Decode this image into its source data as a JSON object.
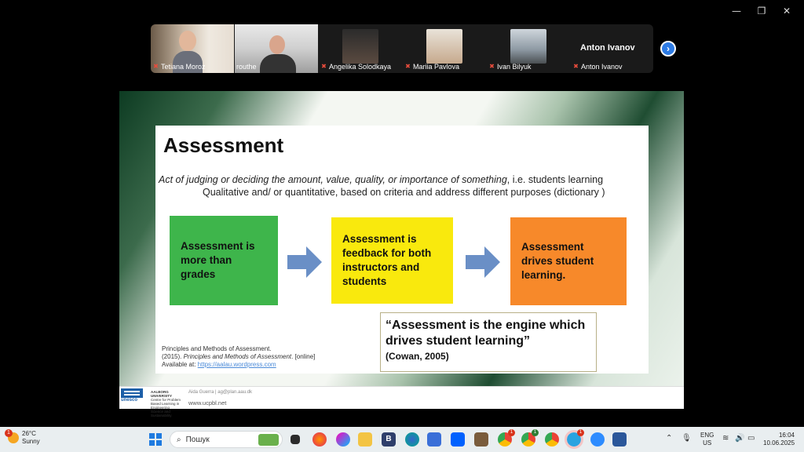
{
  "window": {
    "minimize_icon": "minimize-icon",
    "restore_icon": "restore-icon",
    "close_icon": "close-icon"
  },
  "participants": [
    {
      "name": "Tetiana Moroz",
      "muted": true
    },
    {
      "name": "routhe",
      "muted": false,
      "active_speaker": true
    },
    {
      "name": "Angelika Solodkaya",
      "muted": true
    },
    {
      "name": "Mariia Pavlova",
      "muted": true
    },
    {
      "name": "Ivan Bilyuk",
      "muted": true
    },
    {
      "name": "Anton Ivanov",
      "muted": true,
      "video_off_label": "Anton Ivanov"
    }
  ],
  "slide": {
    "title": "Assessment",
    "definition_italic": "Act of judging or deciding the amount, value, quality, or importance of something",
    "definition_rest": ", i.e. students learning",
    "definition_line2": "Qualitative and/ or quantitative, based on criteria and address different purposes (dictionary )",
    "boxes": [
      {
        "text": "Assessment is more than grades",
        "color": "#3eb54b"
      },
      {
        "text": "Assessment is feedback for both instructors and students",
        "color": "#f9e90d"
      },
      {
        "text": "Assessment drives student learning.",
        "color": "#f7892a"
      }
    ],
    "arrow_color": "#6a8fc6",
    "quote": "“Assessment is the engine which drives student learning”",
    "quote_cite": "(Cowan, 2005)",
    "reference_line1": "Principles and Methods of Assessment.",
    "reference_line2_prefix": "(2015). ",
    "reference_line2_italic": "Principles and Methods of Assessment",
    "reference_line2_suffix": ". [online]",
    "reference_line3_prefix": "Available at: ",
    "reference_link": "https://aalau.wordpress.com",
    "footer_logo_text": "unesco",
    "footer_university": "AALBORG UNIVERSITY",
    "footer_center": "Centre for Problem Based Learning in Engineering Science and Sustainability",
    "footer_contact": "Aida Guerra | ag@plan.aau.dk",
    "footer_url": "www.ucpbl.net"
  },
  "taskbar": {
    "weather_temp": "26°C",
    "weather_desc": "Sunny",
    "weather_badge": "1",
    "search_placeholder": "Пошук",
    "lang_line1": "ENG",
    "lang_line2": "US",
    "time": "16:04",
    "date": "10.06.2025",
    "chrome_badge_1": "1",
    "chrome_badge_2": "1",
    "telegram_badge": "1"
  }
}
